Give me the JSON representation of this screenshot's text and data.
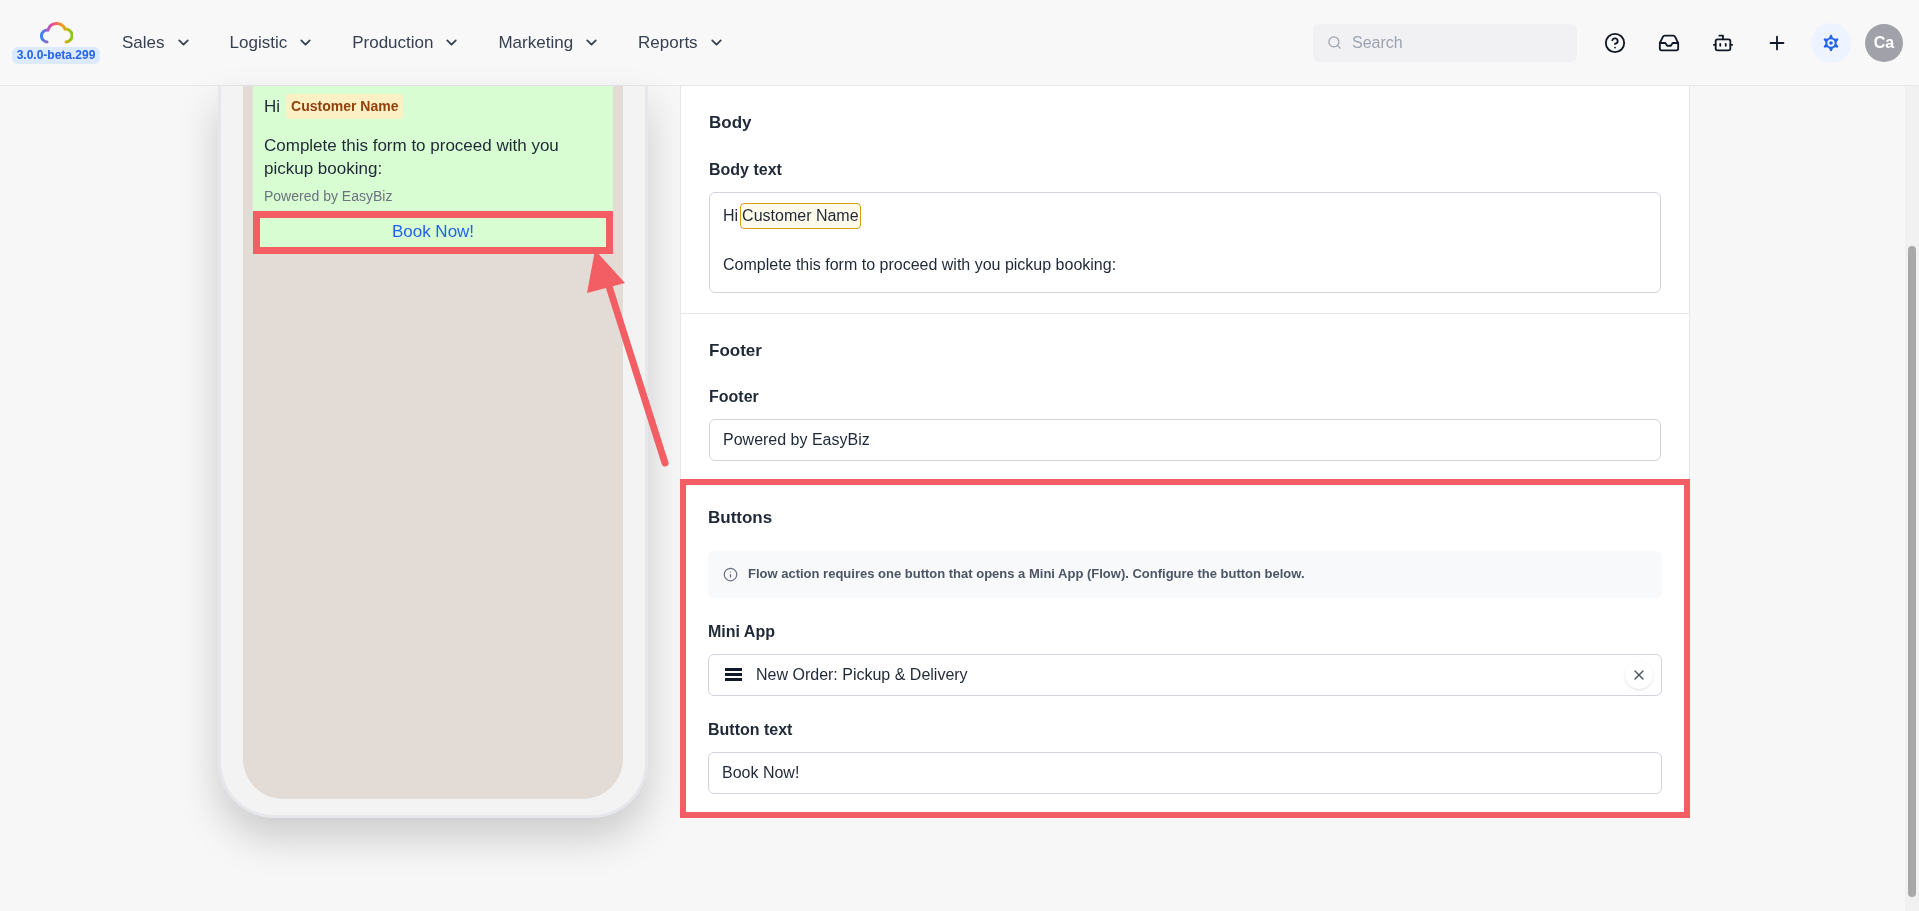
{
  "header": {
    "version": "3.0.0-beta.299",
    "menus": [
      {
        "label": "Sales"
      },
      {
        "label": "Logistic"
      },
      {
        "label": "Production"
      },
      {
        "label": "Marketing"
      },
      {
        "label": "Reports"
      }
    ],
    "search": {
      "placeholder": "Search"
    },
    "tools": [
      {
        "kind": "help",
        "selected": false
      },
      {
        "kind": "inbox",
        "selected": false
      },
      {
        "kind": "bot",
        "selected": false
      },
      {
        "kind": "add",
        "selected": false
      },
      {
        "kind": "settings",
        "selected": true
      }
    ],
    "avatar": "Ca"
  },
  "preview": {
    "greeting": "Hi",
    "variable": "Customer Name",
    "message": "Complete this form to proceed with you pickup booking:",
    "footer": "Powered by EasyBiz",
    "button": "Book Now!",
    "highlighted": true
  },
  "body": {
    "title": "Body",
    "label": "Body text",
    "greeting": "Hi",
    "variable": "Customer Name",
    "message": "Complete this form to proceed with you pickup booking:"
  },
  "footer": {
    "title": "Footer",
    "label": "Footer",
    "value": "Powered by EasyBiz"
  },
  "buttons": {
    "title": "Buttons",
    "highlighted": true,
    "info": "Flow action requires one button that opens a Mini App (Flow). Configure the button below.",
    "mini_app_label": "Mini App",
    "mini_app_value": "New Order: Pickup & Delivery",
    "button_text_label": "Button text",
    "button_text_value": "Book Now!"
  }
}
